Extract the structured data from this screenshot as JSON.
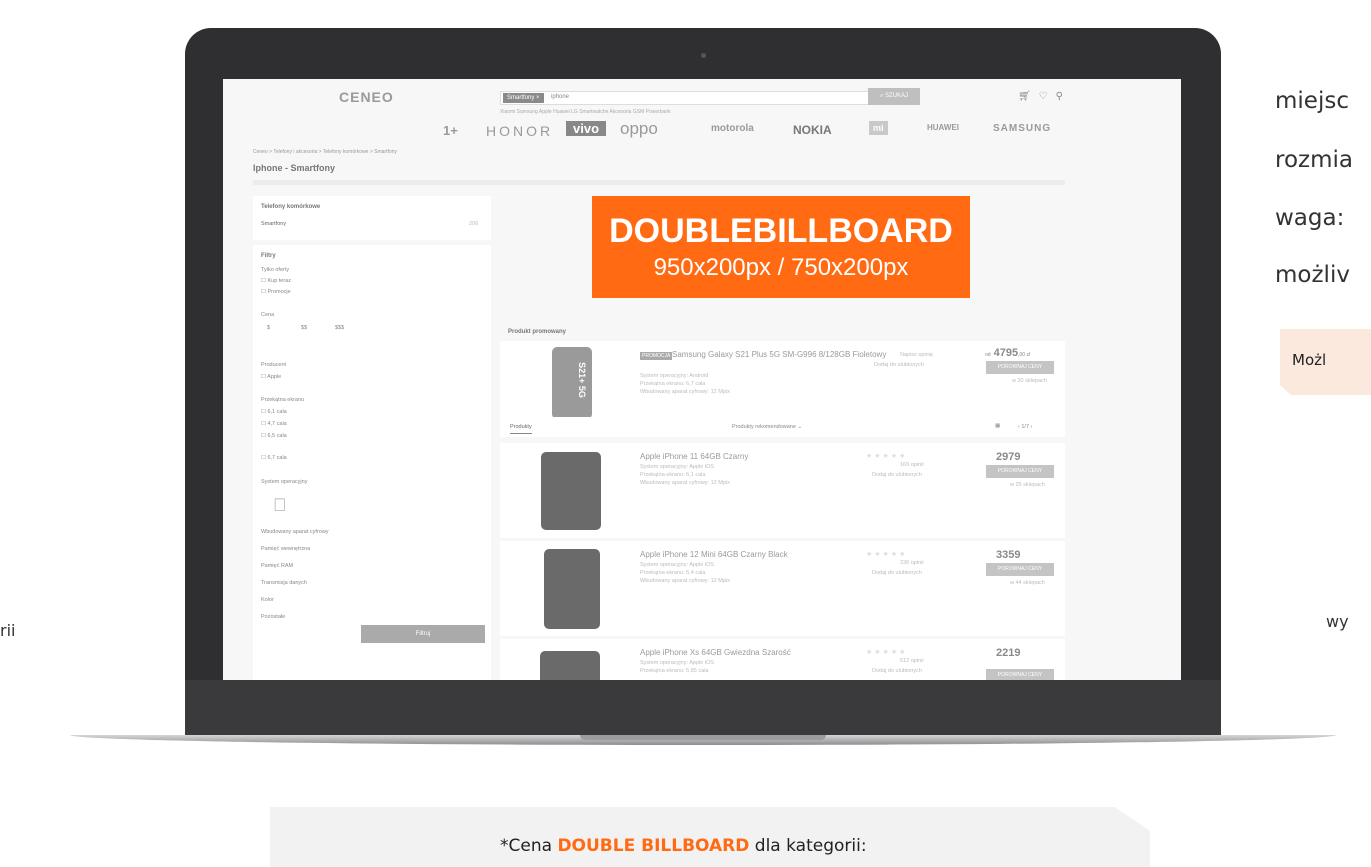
{
  "right_panel": {
    "lines": [
      "miejsc",
      "rozmia",
      "waga:",
      "możliv"
    ],
    "pill_label": "Możl",
    "side_word": "wy"
  },
  "left_panel": {
    "side_word": "rii"
  },
  "bottom_note": {
    "prefix": "*Cena ",
    "highlight": "DOUBLE BILLBOARD",
    "suffix": " dla kategorii:",
    "highlight_color": "#ff6a13"
  },
  "screen": {
    "logo": "CENEO",
    "search": {
      "category_chip": "Smartfony ×",
      "query": "iphone",
      "button": "SZUKAJ",
      "quick_links": "Xiaomi  Samsung  Apple  Huawei  LG  Smartwatche  Akcesoria GSM  Powerbank"
    },
    "brands": [
      "1+",
      "HONOR",
      "vivo",
      "oppo",
      "motorola",
      "NOKIA",
      "mi",
      "HUAWEI",
      "SAMSUNG"
    ],
    "breadcrumb": "Ceneo  >  Telefony i akcesoria  >  Telefony komórkowe  >  Smartfony",
    "page_title": "Iphone - Smartfony",
    "sidebar": {
      "category_heading": "Telefony komórkowe",
      "category_item": "Smartfony",
      "category_count": "206",
      "filters_heading": "Filtry",
      "groups": [
        {
          "label": "Tylko oferty",
          "options": [
            "Kup teraz",
            "Promocje"
          ]
        },
        {
          "label": "Cena",
          "options": [
            "$",
            "$$",
            "$$$"
          ]
        },
        {
          "label": "Producent",
          "options": [
            "Apple"
          ]
        },
        {
          "label": "Przekątna ekranu",
          "options": [
            "6,1 cala",
            "4,7 cala",
            "6,5 cala",
            "6,7 cala"
          ]
        },
        {
          "label": "System operacyjny",
          "options": []
        }
      ],
      "collapsed": [
        "Wbudowany aparat cyfrowy",
        "Pamięć wewnętrzna",
        "Pamięć RAM",
        "Transmisja danych",
        "Kolor",
        "Pozostałe"
      ],
      "filter_button": "Filtruj"
    },
    "billboard": {
      "title": "DOUBLEBILLBOARD",
      "sizes": "950x200px / 750x200px",
      "color": "#ff6a13"
    },
    "promoted": {
      "heading": "Produkt promowany",
      "badge": "PROMOCJA",
      "name": "Samsung Galaxy S21 Plus 5G SM-G996 8/128GB Fioletowy",
      "specs": [
        "System operacyjny: Android",
        "Przekątna ekranu: 6,7 cala",
        "Wbudowany aparat cyfrowy: 12 Mpix"
      ],
      "compare": "POROWNAJ CENY",
      "price": "4795",
      "price_cents": ",00 zł",
      "price_prefix": "od",
      "stores": "w 20 sklepach",
      "actions": [
        "Napisz opinię",
        "Dodaj do ulubionych"
      ],
      "phone_text": "S21+ 5G"
    },
    "list_toolbar": {
      "tab": "Produkty",
      "sort": "Produkty rekomendowane",
      "pager": "‹  1/7  ›"
    },
    "products": [
      {
        "name": "Apple iPhone 11 64GB Czarny",
        "specs": [
          "System operacyjny: Apple iOS",
          "Przekątna ekranu: 6,1 cala",
          "Wbudowany aparat cyfrowy: 12 Mpix"
        ],
        "price": "2979",
        "stores": "w 25 sklepach",
        "reviews": "169 opinii",
        "fav": "Dodaj do ulubionych"
      },
      {
        "name": "Apple iPhone 12 Mini 64GB Czarny Black",
        "specs": [
          "System operacyjny: Apple iOS",
          "Przekątna ekranu: 5,4 cala",
          "Wbudowany aparat cyfrowy: 12 Mpix"
        ],
        "price": "3359",
        "stores": "w 44 sklepach",
        "reviews": "236 opinii",
        "fav": "Dodaj do ulubionych"
      },
      {
        "name": "Apple iPhone Xs 64GB Gwiezdna Szarość",
        "specs": [
          "System operacyjny: Apple iOS",
          "Przekątna ekranu: 5,85 cala"
        ],
        "price": "2219",
        "stores": "",
        "reviews": "512 opinii",
        "fav": "Dodaj do ulubionych"
      }
    ],
    "compare_label": "POROWNAJ CENY"
  }
}
